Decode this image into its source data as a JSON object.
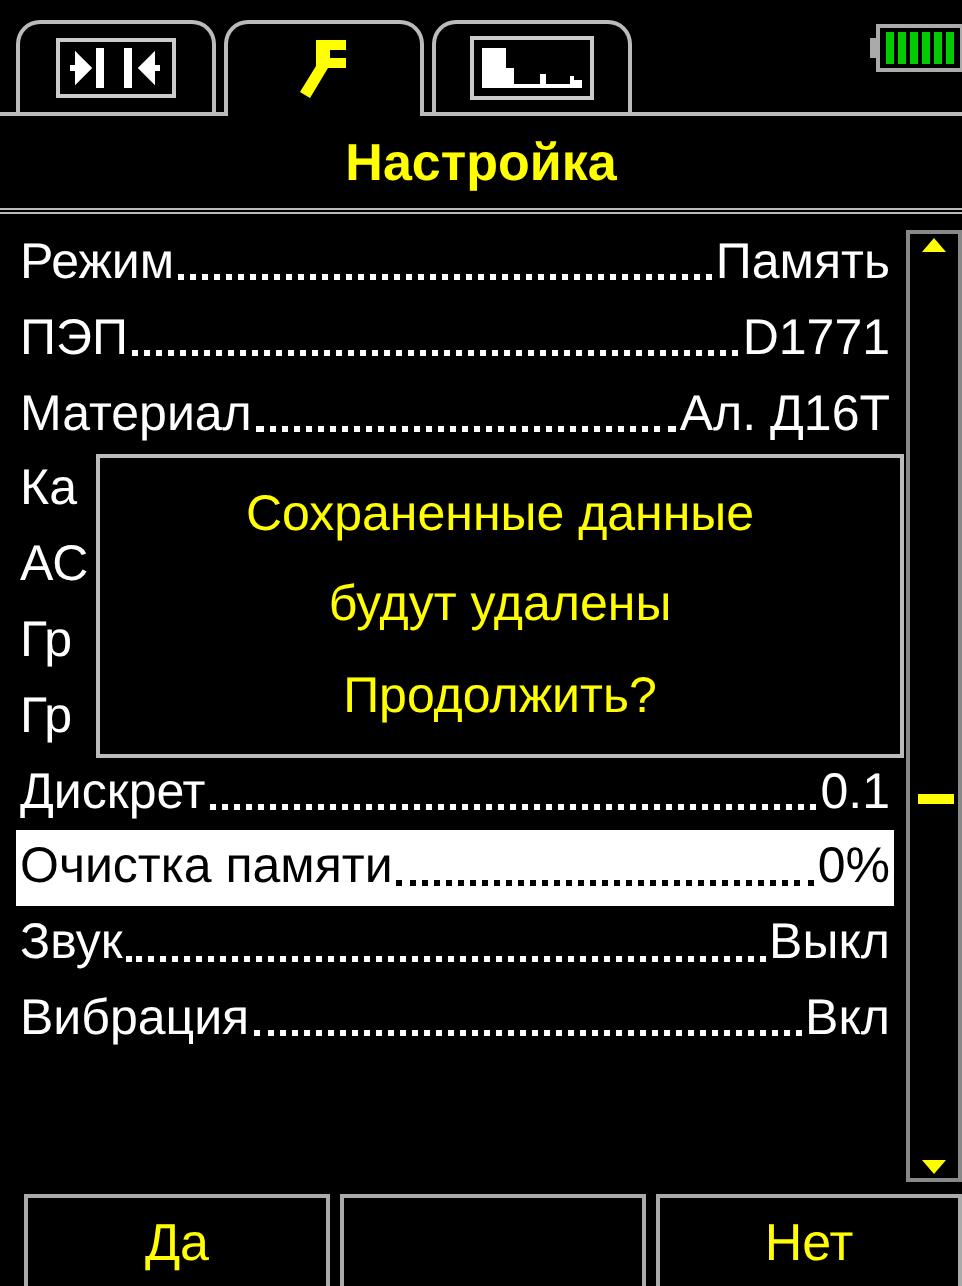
{
  "tabs": [
    {
      "selected": false
    },
    {
      "selected": true
    },
    {
      "selected": false
    }
  ],
  "title": "Настройка",
  "settings": [
    {
      "label": "Режим",
      "value": "Память",
      "selected": false
    },
    {
      "label": "ПЭП",
      "value": "D1771",
      "selected": false
    },
    {
      "label": "Материал",
      "value": "Ал. Д16Т",
      "selected": false
    },
    {
      "label": "Ка",
      "selected": false
    },
    {
      "label": "АС",
      "selected": false
    },
    {
      "label": "Гр",
      "selected": false
    },
    {
      "label": "Гр",
      "selected": false
    },
    {
      "label": "Дискрет",
      "value": "0.1",
      "selected": false
    },
    {
      "label": "Очистка памяти",
      "value": "0%",
      "selected": true
    },
    {
      "label": "Звук",
      "value": "Выкл",
      "selected": false
    },
    {
      "label": "Вибрация",
      "value": "Вкл",
      "selected": false
    }
  ],
  "dialog": {
    "lines": [
      "Сохраненные данные",
      "будут удалены",
      "Продолжить?"
    ]
  },
  "softkeys": {
    "left": "Да",
    "right": "Нет"
  }
}
